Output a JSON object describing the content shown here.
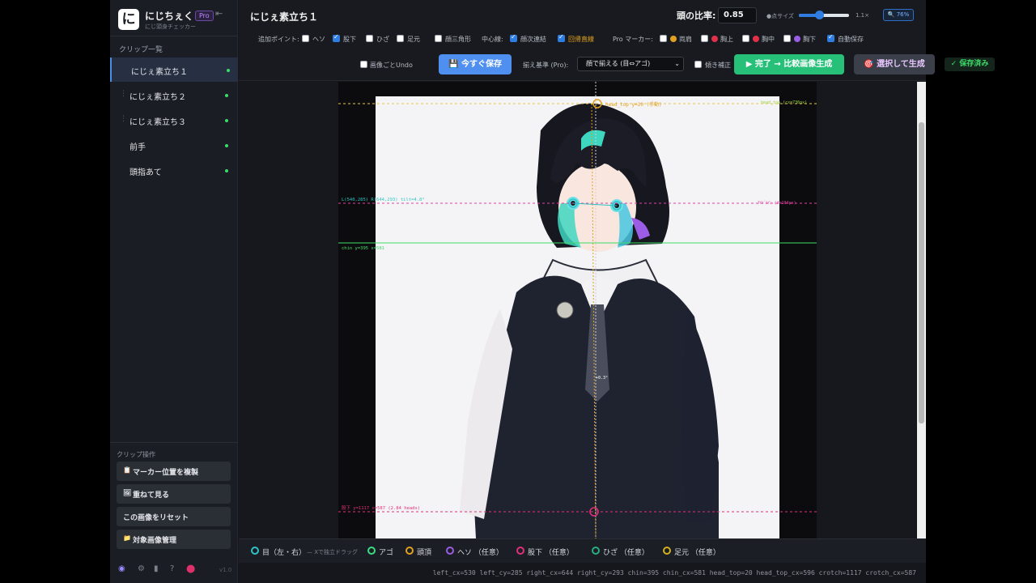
{
  "brand": {
    "logo": "に",
    "name": "にじちぇく",
    "badge": "Pro",
    "subtitle": "にじ頭身チェッカー"
  },
  "sidebar": {
    "title": "クリップ一覧",
    "items": [
      {
        "label": "にじぇ素立ち１"
      },
      {
        "label": "にじぇ素立ち２"
      },
      {
        "label": "にじぇ素立ち３"
      },
      {
        "label": "前手"
      },
      {
        "label": "頭指あて"
      }
    ],
    "ops_title": "クリップ操作",
    "ops": [
      {
        "icon": "📋",
        "label": "マーカー位置を複製"
      },
      {
        "icon": "🖼",
        "label": "重ねて見る"
      },
      {
        "icon": "",
        "label": "この画像をリセット"
      },
      {
        "icon": "📁",
        "label": "対象画像管理"
      }
    ],
    "version": "v1.0"
  },
  "toolbar": {
    "clip_title": "にじぇ素立ち１",
    "ratio_label": "頭の比率:",
    "ratio_value": "0.85",
    "point_size_label": "●点サイズ",
    "point_size_value": 0.4,
    "point_size_text": "1.1×",
    "zoom_label": "🔍 76%",
    "extra_points_label": "追加ポイント:",
    "options": [
      {
        "label": "ヘソ",
        "checked": false
      },
      {
        "label": "股下",
        "checked": true
      },
      {
        "label": "ひざ",
        "checked": false
      },
      {
        "label": "足元",
        "checked": false
      },
      {
        "label": "顔三角形",
        "checked": false
      }
    ],
    "center_line_label": "中心線:",
    "center_options": [
      {
        "label": "顔次連結",
        "checked": true
      },
      {
        "label": "回帰直線",
        "checked": true
      }
    ],
    "pro_marker_label": "Pro マーカー:",
    "pro_markers": [
      {
        "label": "両肩",
        "checked": false,
        "color": "#e0a020"
      },
      {
        "label": "胸上",
        "checked": false,
        "color": "#e0304a"
      },
      {
        "label": "胸中",
        "checked": false,
        "color": "#e0304a"
      },
      {
        "label": "胸下",
        "checked": false,
        "color": "#9b5de5"
      }
    ],
    "autosave_label": "自動保存",
    "autosave_checked": true,
    "undo_label": "画像ごとUndo",
    "save_now": "💾 今すぐ保存",
    "align_label": "揃え基準 (Pro):",
    "align_value": "顔で揃える (目⇔アゴ)",
    "lean_label": "傾き補正",
    "done_button": "▶ 完了 → 比較画像生成",
    "generate_button": "🎯 選択して生成",
    "saved_status": "✓ 保存済み"
  },
  "canvas": {
    "labels": {
      "head_top": "head_top y=20 (手動)",
      "head_top_right": "head_top (cx=736px)",
      "eyes": "L(540,285)  R(644,293)  tilt=4.8°",
      "eyes_right": "ｱｲﾄﾞﾙｲﾝ (d=104px)",
      "chin": "chin y=395 x=581",
      "crotch": "股下 y=1117 x=587  (2.84 heads)",
      "angle": "+0.3°"
    }
  },
  "legend": {
    "items": [
      {
        "label": "目（左・右）",
        "color": "#2ec4c4"
      },
      {
        "label": "アゴ",
        "color": "#3ddc84"
      },
      {
        "label": "頭頂",
        "color": "#e0a020"
      },
      {
        "label": "ヘソ （任意）",
        "color": "#9b5de5"
      },
      {
        "label": "股下 （任意）",
        "color": "#e0307a"
      },
      {
        "label": "ひざ （任意）",
        "color": "#27ae80"
      },
      {
        "label": "足元 （任意）",
        "color": "#d4b020"
      }
    ],
    "hint": "— Xで独立ドラッグ"
  },
  "coords": "left_cx=530 left_cy=285 right_cx=644 right_cy=293 chin=395 chin_cx=581 head_top=20 head_top_cx=596 crotch=1117 crotch_cx=587"
}
